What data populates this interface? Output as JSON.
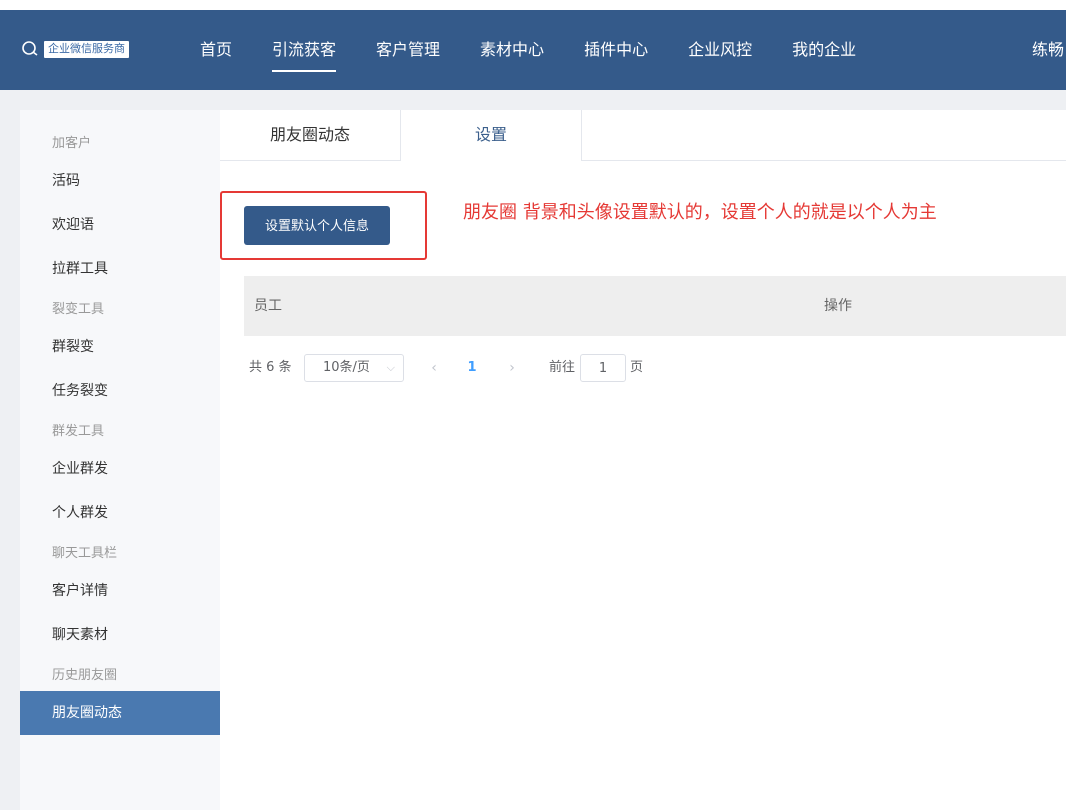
{
  "header": {
    "logo_text": "企业微信服务商",
    "nav": [
      "首页",
      "引流获客",
      "客户管理",
      "素材中心",
      "插件中心",
      "企业风控",
      "我的企业"
    ],
    "active_nav": "引流获客",
    "user_name": "练畅"
  },
  "sidebar": {
    "items": [
      {
        "label": "加客户",
        "kind": "group"
      },
      {
        "label": "活码",
        "kind": "item"
      },
      {
        "label": "欢迎语",
        "kind": "item"
      },
      {
        "label": "拉群工具",
        "kind": "item"
      },
      {
        "label": "裂变工具",
        "kind": "group"
      },
      {
        "label": "群裂变",
        "kind": "item"
      },
      {
        "label": "任务裂变",
        "kind": "item"
      },
      {
        "label": "群发工具",
        "kind": "group"
      },
      {
        "label": "企业群发",
        "kind": "item"
      },
      {
        "label": "个人群发",
        "kind": "item"
      },
      {
        "label": "聊天工具栏",
        "kind": "group"
      },
      {
        "label": "客户详情",
        "kind": "item"
      },
      {
        "label": "聊天素材",
        "kind": "item"
      },
      {
        "label": "历史朋友圈",
        "kind": "group"
      },
      {
        "label": "朋友圈动态",
        "kind": "item",
        "active": true
      }
    ]
  },
  "tabs": [
    "朋友圈动态",
    "设置"
  ],
  "active_tab": "设置",
  "main": {
    "set_default_button": "设置默认个人信息",
    "annotation": "朋友圈 背景和头像设置默认的，设置个人的就是以个人为主"
  },
  "table": {
    "columns": [
      "员工",
      "操作"
    ],
    "rows": []
  },
  "pagination": {
    "total": "共 6 条",
    "page_size": "10条/页",
    "current_page": "1",
    "goto_label": "前往",
    "goto_value": "1",
    "goto_suffix": "页"
  },
  "colors": {
    "header_bg": "#345a8a",
    "sidebar_active": "#4a79b0",
    "annotation_red": "#e53935",
    "page_link": "#409eff"
  }
}
